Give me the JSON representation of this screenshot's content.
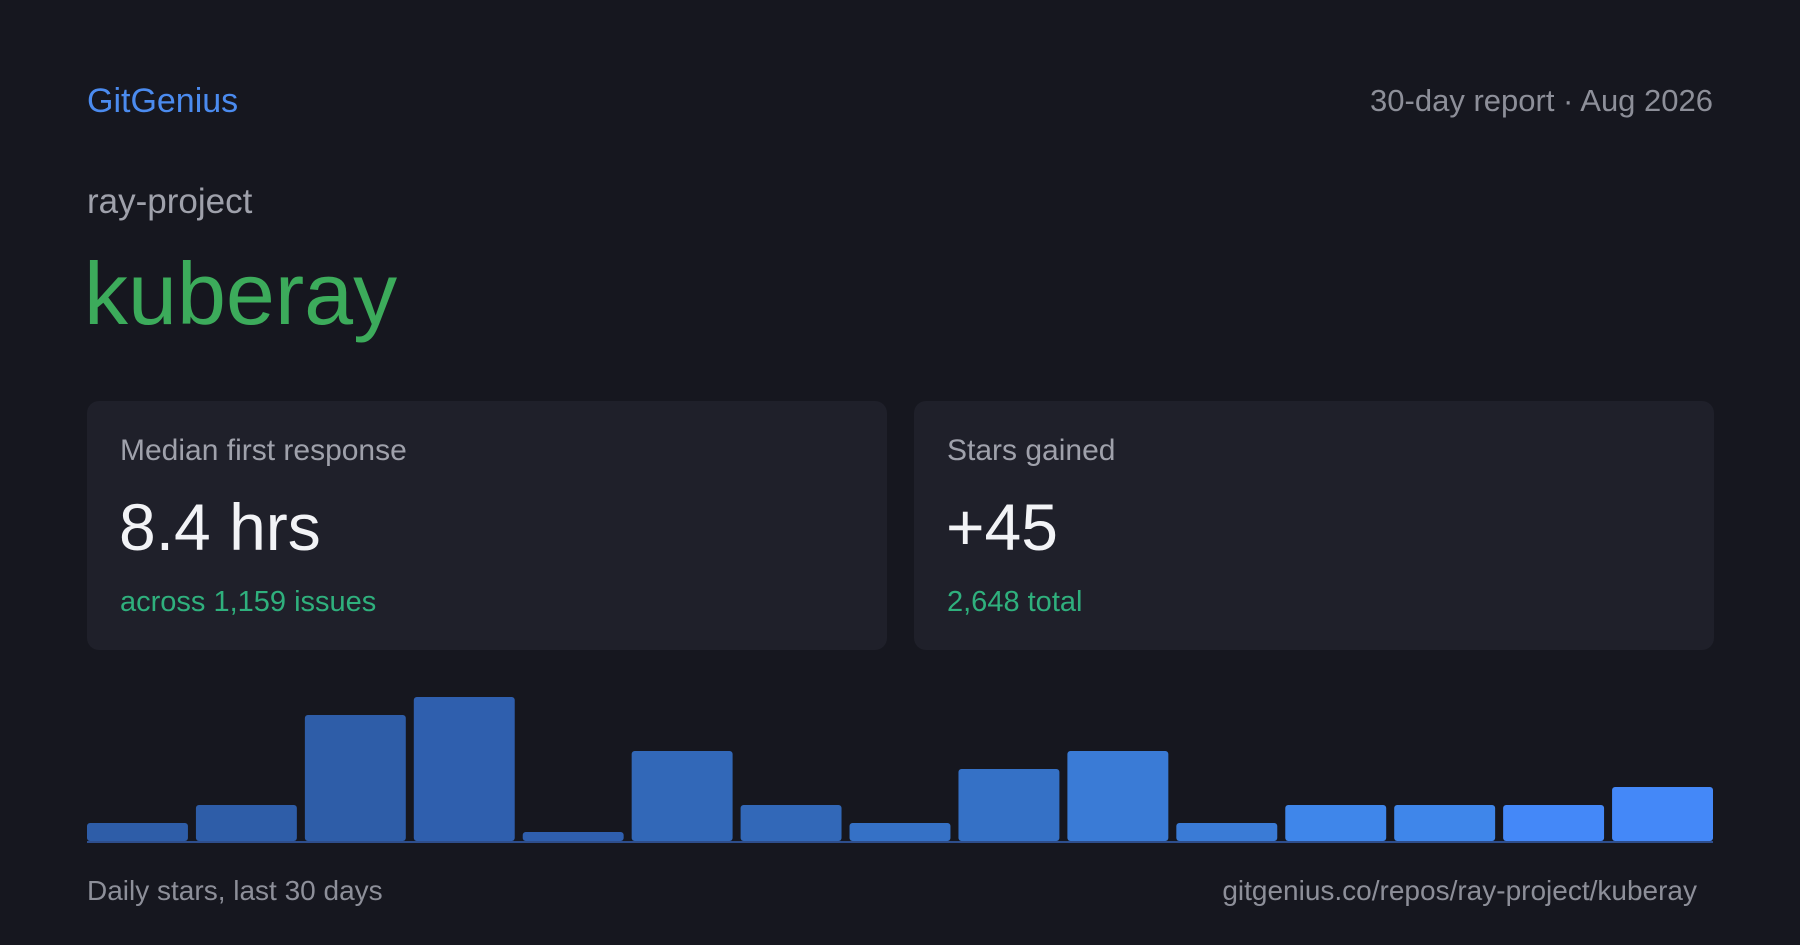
{
  "header": {
    "brand": "GitGenius",
    "report_label": "30-day report · Aug 2026"
  },
  "repo": {
    "owner": "ray-project",
    "name": "kuberay"
  },
  "cards": {
    "response": {
      "label": "Median first response",
      "value": "8.4 hrs",
      "sub": "across 1,159 issues"
    },
    "stars": {
      "label": "Stars gained",
      "value": "+45",
      "sub": "2,648 total"
    }
  },
  "chart_data": {
    "type": "bar",
    "values": [
      1,
      2,
      7,
      8,
      0.5,
      5,
      2,
      1,
      4,
      5,
      1,
      2,
      2,
      2,
      3
    ],
    "ylim": [
      0,
      8
    ],
    "colors": [
      "#2e5da8",
      "#2f5fae",
      "#3268b8",
      "#3571c6",
      "#3a7bd6",
      "#3f86ea",
      "#4488f8"
    ],
    "baseline_color": "#2e4e8c"
  },
  "footer": {
    "caption": "Daily stars, last 30 days",
    "url": "gitgenius.co/repos/ray-project/kuberay"
  },
  "colors": {
    "background": "#16171f",
    "card": "#1f202a",
    "brand": "#4b8bef",
    "repo_name": "#3cab5b",
    "positive": "#2fb07d"
  }
}
